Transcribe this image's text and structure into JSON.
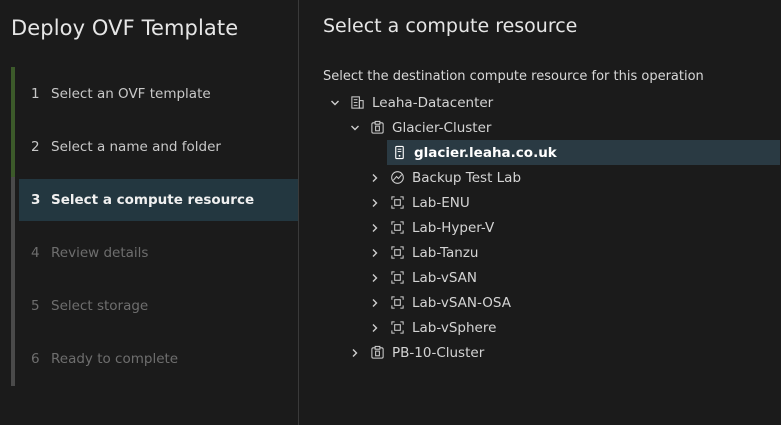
{
  "wizard": {
    "title": "Deploy OVF Template",
    "steps": [
      {
        "num": "1",
        "label": "Select an OVF template",
        "state": "done"
      },
      {
        "num": "2",
        "label": "Select a name and folder",
        "state": "done"
      },
      {
        "num": "3",
        "label": "Select a compute resource",
        "state": "current"
      },
      {
        "num": "4",
        "label": "Review details",
        "state": "pending"
      },
      {
        "num": "5",
        "label": "Select storage",
        "state": "pending"
      },
      {
        "num": "6",
        "label": "Ready to complete",
        "state": "pending"
      }
    ]
  },
  "main": {
    "title": "Select a compute resource",
    "instructions": "Select the destination compute resource for this operation",
    "tree": [
      {
        "label": "Leaha-Datacenter",
        "icon": "datacenter-icon",
        "caret": "chevron-down-icon"
      },
      {
        "label": "Glacier-Cluster",
        "icon": "cluster-icon",
        "caret": "chevron-down-icon"
      },
      {
        "label": "glacier.leaha.co.uk",
        "icon": "host-icon",
        "caret": "",
        "selected": true
      },
      {
        "label": "Backup Test Lab",
        "icon": "resource-pool-icon",
        "caret": "chevron-right-icon"
      },
      {
        "label": "Lab-ENU",
        "icon": "vapp-icon",
        "caret": "chevron-right-icon"
      },
      {
        "label": "Lab-Hyper-V",
        "icon": "vapp-icon",
        "caret": "chevron-right-icon"
      },
      {
        "label": "Lab-Tanzu",
        "icon": "vapp-icon",
        "caret": "chevron-right-icon"
      },
      {
        "label": "Lab-vSAN",
        "icon": "vapp-icon",
        "caret": "chevron-right-icon"
      },
      {
        "label": "Lab-vSAN-OSA",
        "icon": "vapp-icon",
        "caret": "chevron-right-icon"
      },
      {
        "label": "Lab-vSphere",
        "icon": "vapp-icon",
        "caret": "chevron-right-icon"
      },
      {
        "label": "PB-10-Cluster",
        "icon": "cluster-icon",
        "caret": "chevron-right-icon"
      }
    ]
  },
  "colors": {
    "background": "#1b1b1b",
    "current_step_bg": "#233740",
    "selected_row_bg": "#2a3a43",
    "progress_fill": "#3c5a2a"
  }
}
